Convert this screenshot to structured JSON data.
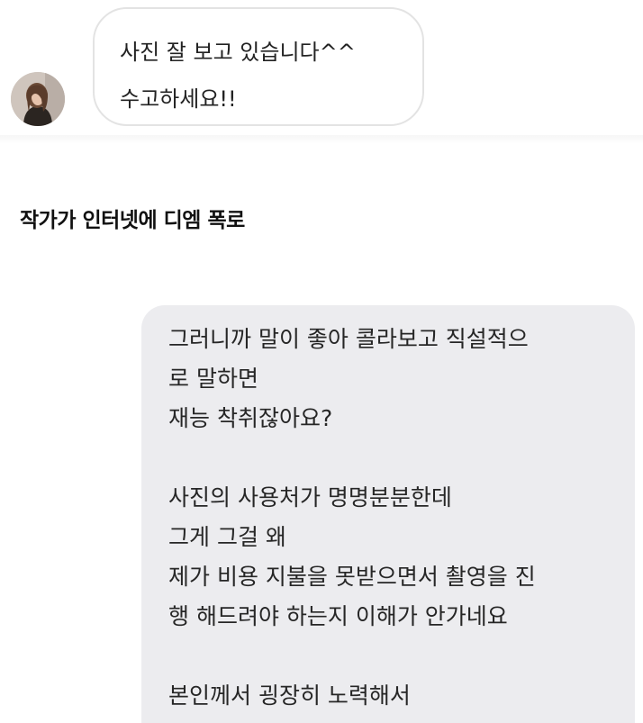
{
  "dm_reply": {
    "lines": [
      "사진 잘 보고 있습니다^^",
      "수고하세요!!"
    ]
  },
  "caption": "작가가 인터넷에 디엠 폭로",
  "dm_message": {
    "lines": [
      "그러니까 말이 좋아 콜라보고 직설적으",
      "로 말하면",
      "재능 착취잖아요?",
      "",
      "사진의 사용처가 명명분분한데",
      "그게 그걸 왜",
      "제가 비용 지불을 못받으면서 촬영을 진",
      "행 해드려야 하는지 이해가 안가네요",
      "",
      "본인께서 굉장히 노력해서"
    ]
  },
  "colors": {
    "gray_bubble": "#ececef",
    "incoming_bubble_border": "#e3e3e3",
    "text": "#222222"
  }
}
